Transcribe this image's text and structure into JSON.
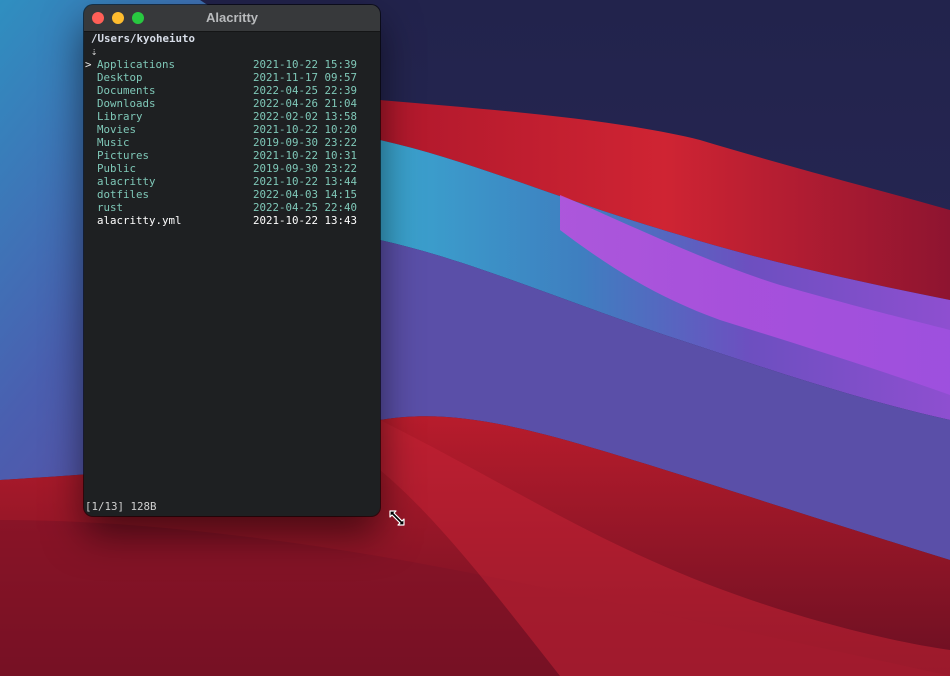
{
  "window": {
    "title": "Alacritty"
  },
  "terminal": {
    "path": "/Users/kyoheiuto",
    "sort_indicator": "⇣",
    "cursor": ">",
    "entries": [
      {
        "name": "Applications",
        "date": "2021-10-22 15:39",
        "kind": "dir"
      },
      {
        "name": "Desktop",
        "date": "2021-11-17 09:57",
        "kind": "dir"
      },
      {
        "name": "Documents",
        "date": "2022-04-25 22:39",
        "kind": "dir"
      },
      {
        "name": "Downloads",
        "date": "2022-04-26 21:04",
        "kind": "dir"
      },
      {
        "name": "Library",
        "date": "2022-02-02 13:58",
        "kind": "dir"
      },
      {
        "name": "Movies",
        "date": "2021-10-22 10:20",
        "kind": "dir"
      },
      {
        "name": "Music",
        "date": "2019-09-30 23:22",
        "kind": "dir"
      },
      {
        "name": "Pictures",
        "date": "2021-10-22 10:31",
        "kind": "dir"
      },
      {
        "name": "Public",
        "date": "2019-09-30 23:22",
        "kind": "dir"
      },
      {
        "name": "alacritty",
        "date": "2021-10-22 13:44",
        "kind": "dir"
      },
      {
        "name": "dotfiles",
        "date": "2022-04-03 14:15",
        "kind": "dir"
      },
      {
        "name": "rust",
        "date": "2022-04-25 22:40",
        "kind": "dir"
      },
      {
        "name": "alacritty.yml",
        "date": "2021-10-22 13:43",
        "kind": "file"
      }
    ],
    "status": "[1/13] 128B"
  },
  "colors": {
    "directory": "#7fc8b8",
    "file": "#ffffff",
    "terminal_bg": "#1e2022"
  }
}
